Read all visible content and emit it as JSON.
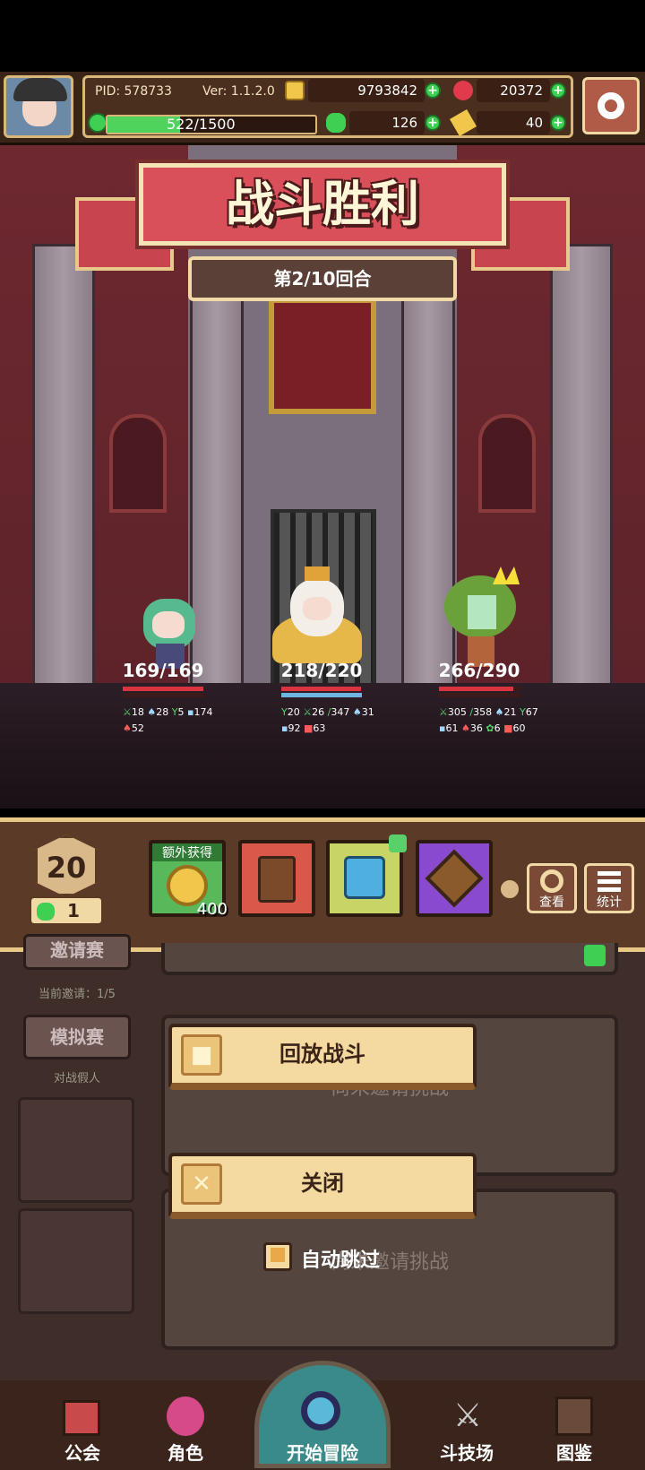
{
  "header": {
    "pid": "PID: 578733",
    "version": "Ver: 1.1.2.0",
    "gold": "9793842",
    "gems": "20372",
    "exp": "522/1500",
    "clover": "126",
    "tickets": "40",
    "exp_fraction": 0.348
  },
  "battle": {
    "title": "战斗胜利",
    "round": "第2/10回合"
  },
  "heroes": [
    {
      "hp": "169/169",
      "hp_fraction": 1.0,
      "stats_row1": [
        "18",
        "28",
        "5",
        "174"
      ],
      "stats_row2": [
        "52"
      ]
    },
    {
      "hp": "218/220",
      "hp_fraction": 0.99,
      "stats_row1": [
        "20",
        "26",
        "347",
        "31"
      ],
      "stats_row2": [
        "92",
        "63"
      ]
    },
    {
      "hp": "266/290",
      "hp_fraction": 0.917,
      "stats_row1": [
        "305",
        "358",
        "21",
        "67"
      ],
      "stats_row2": [
        "61",
        "36",
        "6",
        "60"
      ]
    }
  ],
  "reward": {
    "level": "20",
    "clover_count": "1",
    "extra_label": "额外获得",
    "coin_amount": "400",
    "view_label": "查看",
    "stats_label": "统计"
  },
  "lower": {
    "invite_label": "邀请赛",
    "current_invites": "当前邀请：1/5",
    "sim_label": "模拟赛",
    "sim_caption": "对战假人",
    "waiting_1": "尚未邀请挑战",
    "waiting_2": "尚未邀请挑战",
    "replay_label": "回放战斗",
    "close_label": "关闭",
    "auto_skip_label": "自动跳过",
    "auto_skip_checked": true
  },
  "nav": {
    "guild": "公会",
    "role": "角色",
    "adventure": "开始冒险",
    "arena": "斗技场",
    "codex": "图鉴"
  },
  "colors": {
    "banner_red": "#d9505a",
    "hp_red": "#d9343f",
    "mp_blue": "#6fb4e0",
    "plus_green": "#3fcf53"
  }
}
